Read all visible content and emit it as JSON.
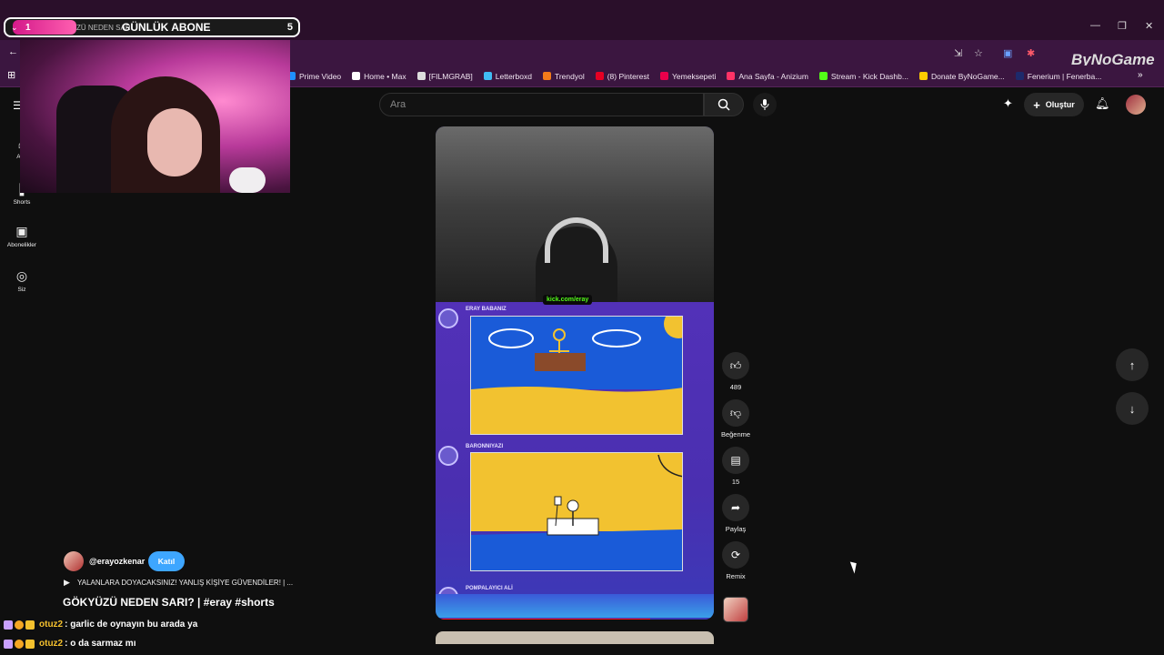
{
  "subgoal": {
    "current": "1",
    "scroll_text": "ZÜ NEDEN SARI",
    "title": "GÜNLÜK ABONE",
    "target": "5"
  },
  "browser": {
    "bookmarks": [
      {
        "label": "Prime Video",
        "color": "#1f8fff"
      },
      {
        "label": "Home • Max",
        "color": "#ffffff"
      },
      {
        "label": "[FILMGRAB]",
        "color": "#dddddd"
      },
      {
        "label": "Letterboxd",
        "color": "#40bcf4"
      },
      {
        "label": "Trendyol",
        "color": "#f27a1a"
      },
      {
        "label": "(8) Pinterest",
        "color": "#e60023"
      },
      {
        "label": "Yemeksepeti",
        "color": "#ea004b"
      },
      {
        "label": "Ana Sayfa - Anizium",
        "color": "#ff3366"
      },
      {
        "label": "Stream - Kick Dashb...",
        "color": "#53fc18"
      },
      {
        "label": "Donate ByNoGame...",
        "color": "#ffcc00"
      },
      {
        "label": "Fenerium | Fenerba...",
        "color": "#1d2a6b"
      }
    ],
    "overlay_brand": "ByNoGame"
  },
  "sidebar": {
    "items": [
      {
        "label": "Ana",
        "icon": "home-icon"
      },
      {
        "label": "Shorts",
        "icon": "shorts-icon"
      },
      {
        "label": "Abonelikler",
        "icon": "subscriptions-icon"
      },
      {
        "label": "Siz",
        "icon": "profile-icon"
      }
    ]
  },
  "header": {
    "search_placeholder": "Ara",
    "create_label": "Oluştur"
  },
  "short": {
    "cam_tag": "kick.com/eray",
    "players": [
      "ERAY BABANIZ",
      "BARONNIYAZI",
      "POMPALAYICI ALİ"
    ],
    "progress": 0.77
  },
  "actions": {
    "like_count": "489",
    "dislike_label": "Beğenme",
    "comment_count": "15",
    "share_label": "Paylaş",
    "remix_label": "Remix"
  },
  "meta": {
    "channel": "@erayozkenar",
    "join_label": "Katıl",
    "related": "YALANLARA DOYACAKSINIZ! YANLIŞ KİŞİYE GÜVENDİLER! | ...",
    "title": "GÖKYÜZÜ NEDEN SARI? | #eray #shorts"
  },
  "chat": [
    {
      "user": "otuz2",
      "message": ": garlic de oynayın bu arada ya"
    },
    {
      "user": "otuz2",
      "message": ": o da sarmaz mı"
    }
  ]
}
